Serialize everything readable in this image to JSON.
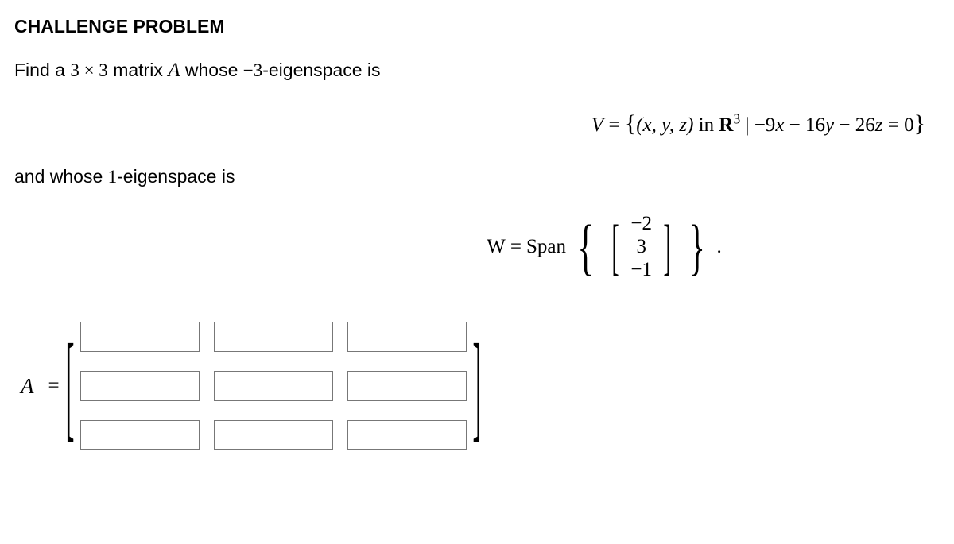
{
  "title": "CHALLENGE PROBLEM",
  "prompt": {
    "prefix": "Find a ",
    "dim": "3 × 3",
    "mid": " matrix ",
    "matrix_name": "A",
    "suffix1": " whose ",
    "eig1": "−3",
    "suffix2": "-eigenspace is"
  },
  "equation_v": {
    "lhs": "V",
    "eq": " = ",
    "lbrace": "{",
    "tuple": "(x, y, z)",
    "in_word": " in ",
    "space": "R",
    "exp": "3",
    "bar": " | ",
    "expr_a": "−9",
    "var_x": "x",
    "expr_b": " − 16",
    "var_y": "y",
    "expr_c": " − 26",
    "var_z": "z",
    "expr_d": " = 0",
    "rbrace": "}"
  },
  "prompt2": {
    "prefix": "and whose ",
    "eig2": "1",
    "suffix": "-eigenspace is"
  },
  "equation_w": {
    "lhs": "W",
    "eq": " = ",
    "span_word": "Span",
    "vector": [
      "−2",
      "3",
      "−1"
    ],
    "period": "."
  },
  "matrix_input": {
    "label": "A",
    "eq": " = ",
    "rows": 3,
    "cols": 3,
    "values": [
      [
        "",
        "",
        ""
      ],
      [
        "",
        "",
        ""
      ],
      [
        "",
        "",
        ""
      ]
    ]
  }
}
